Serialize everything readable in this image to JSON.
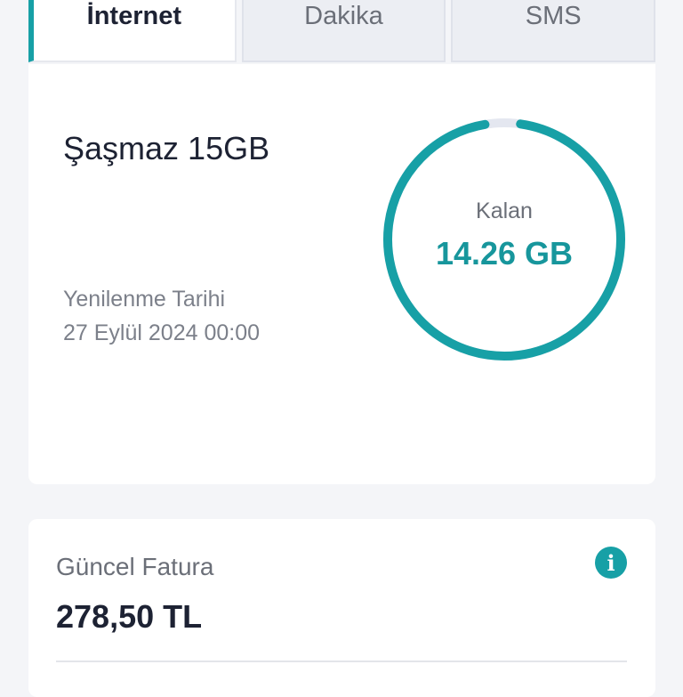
{
  "tabs": [
    {
      "label": "İnternet",
      "active": true
    },
    {
      "label": "Dakika",
      "active": false
    },
    {
      "label": "SMS",
      "active": false
    }
  ],
  "usage": {
    "package_name": "Şaşmaz 15GB",
    "renew_label": "Yenilenme Tarihi",
    "renew_date": "27 Eylül 2024 00:00",
    "remaining_label": "Kalan",
    "remaining_value": "14.26 GB",
    "remaining_fraction": 0.951,
    "colors": {
      "ring": "#17a0a6",
      "track": "#e4e7f0",
      "value": "#17969c"
    }
  },
  "bill": {
    "label": "Güncel Fatura",
    "amount": "278,50 TL",
    "info_icon": "info-icon"
  }
}
